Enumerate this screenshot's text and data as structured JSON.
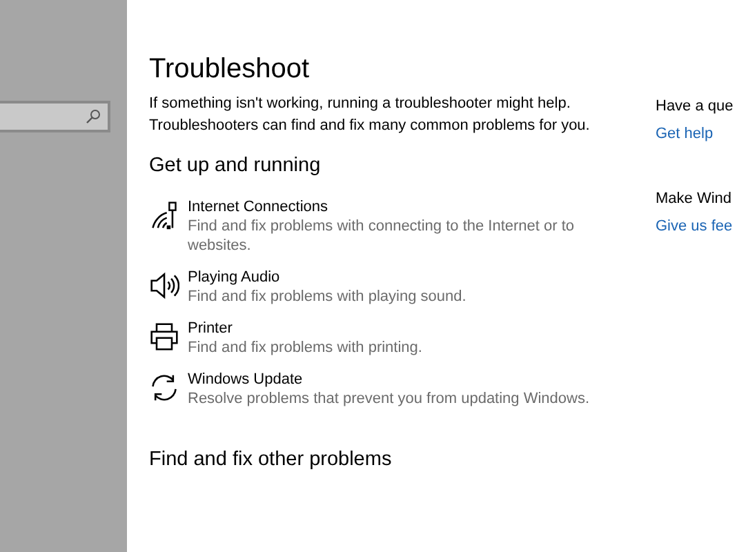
{
  "page": {
    "title": "Troubleshoot",
    "description": "If something isn't working, running a troubleshooter might help. Troubleshooters can find and fix many common problems for you."
  },
  "sections": [
    {
      "heading": "Get up and running",
      "items": [
        {
          "kind": "network",
          "title": "Internet Connections",
          "description": "Find and fix problems with connecting to the Internet or to websites."
        },
        {
          "kind": "audio",
          "title": "Playing Audio",
          "description": "Find and fix problems with playing sound."
        },
        {
          "kind": "printer",
          "title": "Printer",
          "description": "Find and fix problems with printing."
        },
        {
          "kind": "update",
          "title": "Windows Update",
          "description": "Resolve problems that prevent you from updating Windows."
        }
      ]
    },
    {
      "heading": "Find and fix other problems"
    }
  ],
  "side_panel": [
    {
      "question": "Have a que",
      "link": "Get help"
    },
    {
      "question": "Make Wind",
      "link": "Give us fee"
    }
  ]
}
